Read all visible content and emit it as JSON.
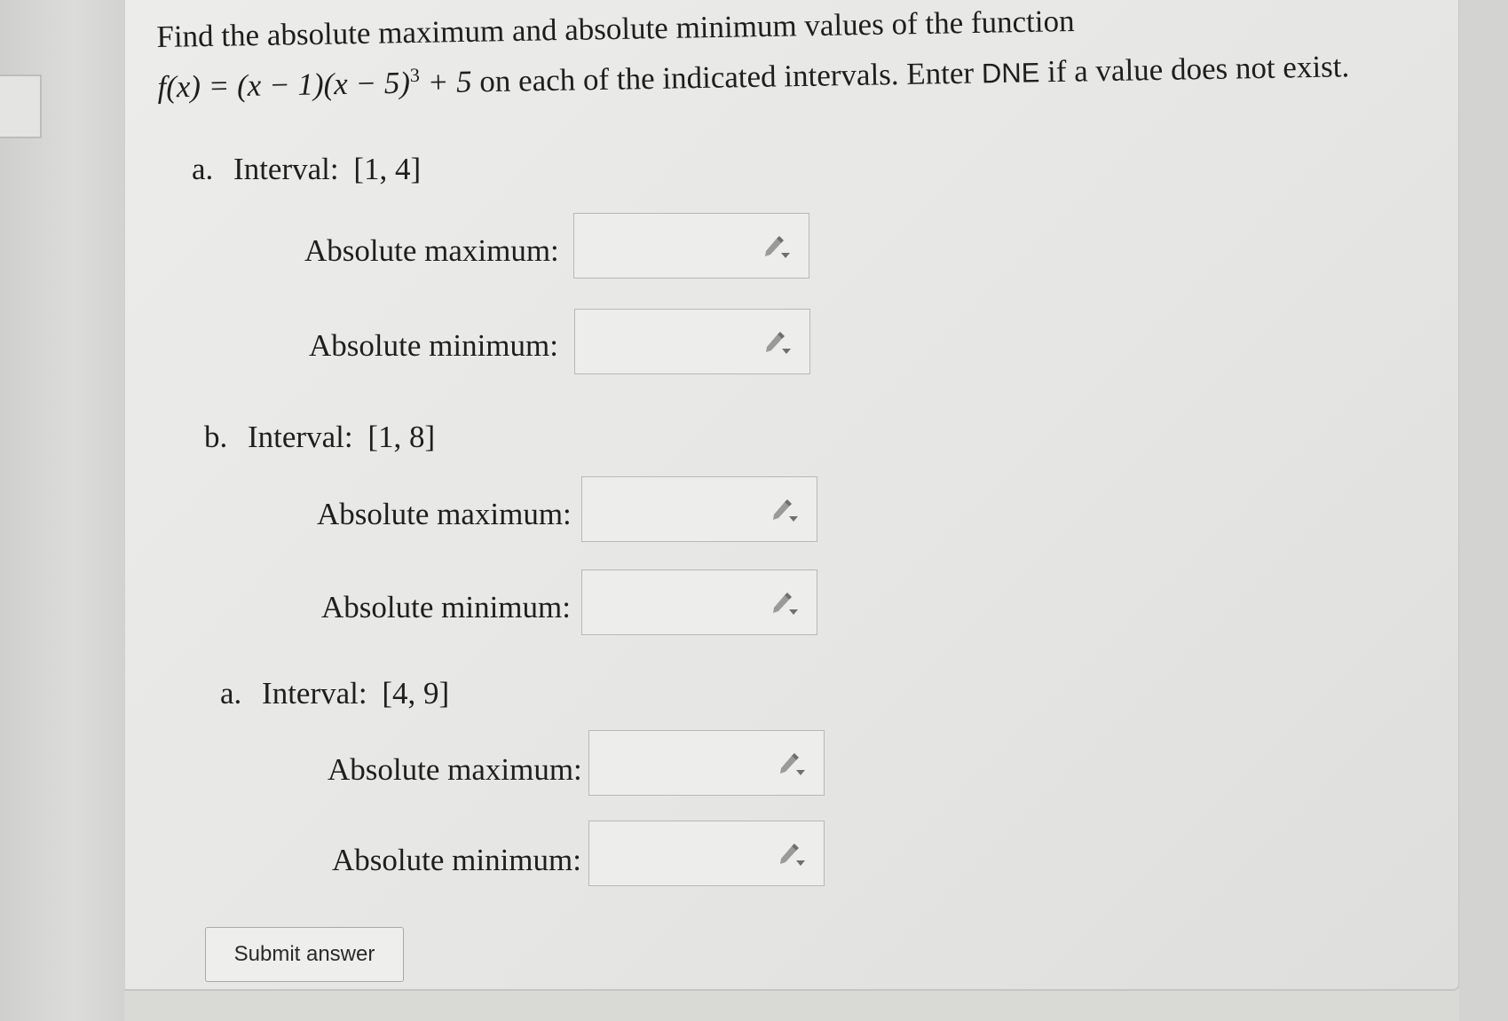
{
  "prompt": {
    "line1": "Find the absolute maximum and absolute minimum values of the function",
    "func": "f(x) = (x − 1)(x − 5)",
    "exponent": "3",
    "func_tail": " + 5",
    "line2_a": " on each of the indicated intervals. Enter ",
    "dne": "DNE",
    "line2_b": " if a value does not exist."
  },
  "parts": [
    {
      "letter": "a.",
      "interval_label": "Interval:",
      "interval": "[1, 4]",
      "max_label": "Absolute maximum:",
      "min_label": "Absolute minimum:",
      "max_value": "",
      "min_value": ""
    },
    {
      "letter": "b.",
      "interval_label": "Interval:",
      "interval": "[1, 8]",
      "max_label": "Absolute maximum:",
      "min_label": "Absolute minimum:",
      "max_value": "",
      "min_value": ""
    },
    {
      "letter": "a.",
      "interval_label": "Interval:",
      "interval": "[4, 9]",
      "max_label": "Absolute maximum:",
      "min_label": "Absolute minimum:",
      "max_value": "",
      "min_value": ""
    }
  ],
  "submit_label": "Submit answer",
  "icons": {
    "field_icon": "pencil-dropdown-icon"
  }
}
